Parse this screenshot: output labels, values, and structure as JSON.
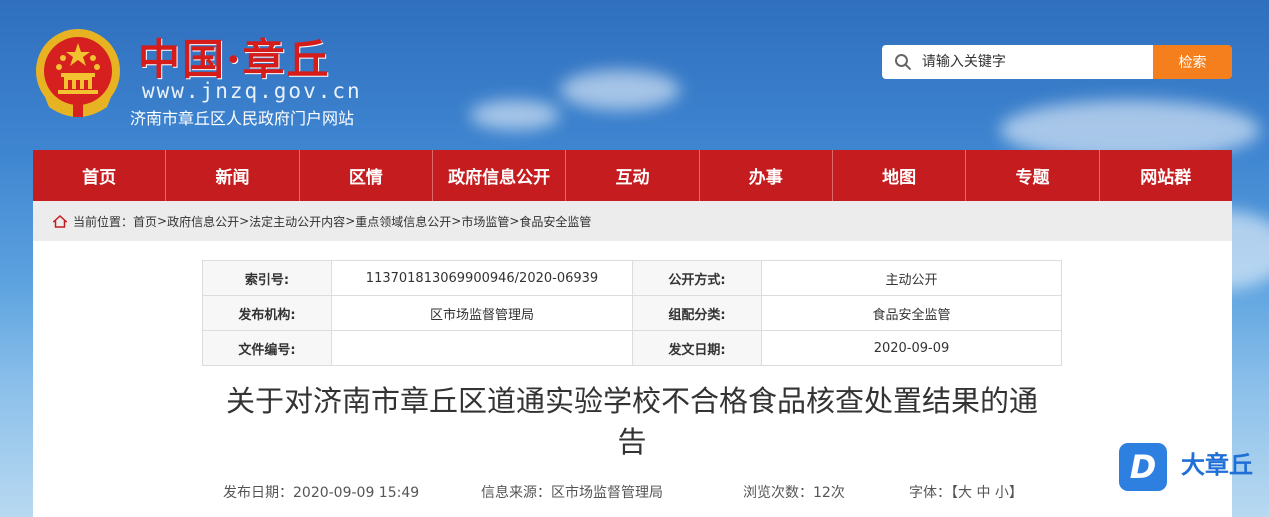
{
  "header": {
    "site_name": "中国·章丘",
    "domain": "www.jnzq.gov.cn",
    "subtitle": "济南市章丘区人民政府门户网站"
  },
  "search": {
    "placeholder": "请输入关键字",
    "button_label": "检索"
  },
  "nav": {
    "items": [
      "首页",
      "新闻",
      "区情",
      "政府信息公开",
      "互动",
      "办事",
      "地图",
      "专题",
      "网站群"
    ]
  },
  "breadcrumb": {
    "label": "当前位置：",
    "items": [
      "首页",
      "政府信息公开",
      "法定主动公开内容",
      "重点领域信息公开",
      "市场监管",
      "食品安全监管"
    ],
    "separator": ">"
  },
  "meta": {
    "index_key": "索引号:",
    "index_value": "113701813069900946/2020-06939",
    "open_mode_key": "公开方式:",
    "open_mode_value": "主动公开",
    "publisher_key": "发布机构:",
    "publisher_value": "区市场监督管理局",
    "category_key": "组配分类:",
    "category_value": "食品安全监管",
    "docno_key": "文件编号:",
    "docno_value": "",
    "date_key": "发文日期:",
    "date_value": "2020-09-09"
  },
  "article": {
    "title_line1": "关于对济南市章丘区道通实验学校不合格食品核查处置结果的通",
    "title_line2": "告",
    "publish_date": "发布日期：2020-09-09 15:49",
    "source": "信息来源：区市场监督管理局",
    "views": "浏览次数：12次",
    "font_label": "字体：【",
    "font_large": "大",
    "font_medium": "中",
    "font_small": "小",
    "font_close": "】"
  },
  "floating_logo": {
    "mark": "D",
    "text": "大章丘"
  },
  "colors": {
    "nav_red": "#c51d1f",
    "search_orange": "#f57f1c",
    "logo_blue": "#2d7fe0"
  }
}
